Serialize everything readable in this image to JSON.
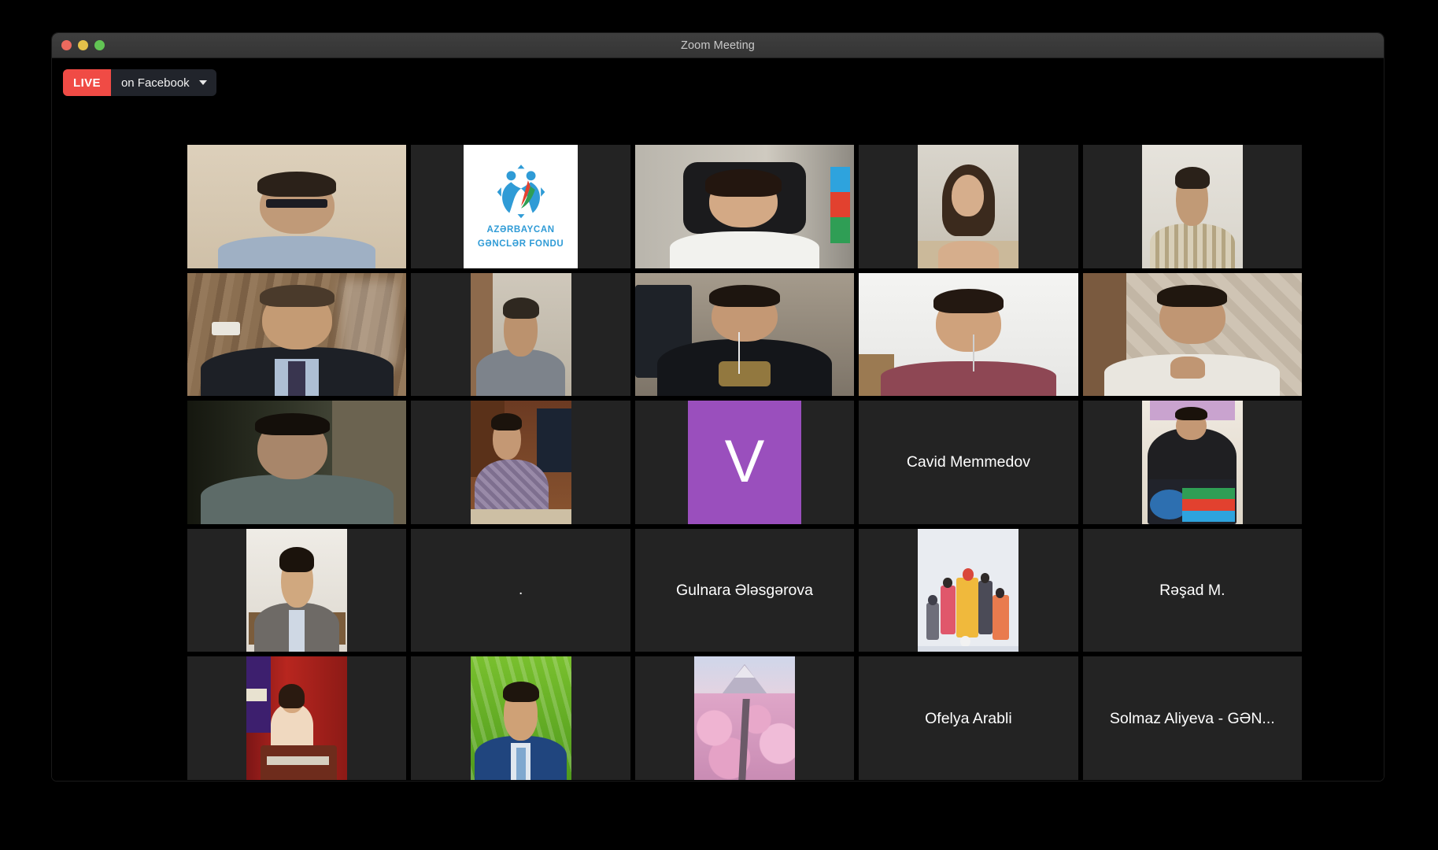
{
  "window": {
    "title": "Zoom Meeting",
    "traffic_lights": [
      "close-red",
      "minimize-yellow",
      "maximize-green"
    ]
  },
  "live": {
    "badge_label": "LIVE",
    "destination": "on Facebook",
    "caret_icon": "chevron-down-icon",
    "badge_color": "#f04b45",
    "pill_bg": "#21242b"
  },
  "gallery": {
    "columns": 5,
    "rows": 5,
    "active_speaker_border_color": "#d6e84f",
    "tile_bg": "#232323",
    "participants": [
      {
        "index": 1,
        "name": "",
        "type": "video",
        "speaking": false,
        "aspect": "full",
        "scene": "man-glasses-beige-wall"
      },
      {
        "index": 2,
        "name": "",
        "type": "logo",
        "speaking": false,
        "aspect": "portrait",
        "logo_line1": "AZƏRBAYCAN",
        "logo_line2": "GƏNCLƏR FONDU",
        "logo_color": "#2f9bd6"
      },
      {
        "index": 3,
        "name": "",
        "type": "video",
        "speaking": false,
        "aspect": "full",
        "scene": "woman-office-chair-flag"
      },
      {
        "index": 4,
        "name": "",
        "type": "video",
        "speaking": false,
        "aspect": "narrow",
        "scene": "young-woman-room"
      },
      {
        "index": 5,
        "name": "",
        "type": "video",
        "speaking": false,
        "aspect": "narrow",
        "scene": "man-plaid-shirt"
      },
      {
        "index": 6,
        "name": "",
        "type": "video",
        "speaking": true,
        "aspect": "full",
        "scene": "man-suit-wood-wall"
      },
      {
        "index": 7,
        "name": "",
        "type": "video",
        "speaking": false,
        "aspect": "narrow",
        "scene": "man-grey-shirt"
      },
      {
        "index": 8,
        "name": "",
        "type": "video",
        "speaking": false,
        "aspect": "full",
        "scene": "young-man-black-tshirt"
      },
      {
        "index": 9,
        "name": "",
        "type": "video",
        "speaking": false,
        "aspect": "full",
        "scene": "young-man-maroon-tshirt"
      },
      {
        "index": 10,
        "name": "",
        "type": "video",
        "speaking": false,
        "aspect": "full",
        "scene": "man-white-tshirt-hand-chin"
      },
      {
        "index": 11,
        "name": "",
        "type": "video",
        "speaking": false,
        "aspect": "full",
        "scene": "man-dark-room"
      },
      {
        "index": 12,
        "name": "",
        "type": "photo",
        "speaking": false,
        "aspect": "narrow",
        "scene": "man-conference-photo"
      },
      {
        "index": 13,
        "name": "",
        "type": "avatar",
        "speaking": false,
        "aspect": "portrait",
        "letter": "V",
        "avatar_color": "#9a4fbd"
      },
      {
        "index": 14,
        "name": "Cavid Memmedov",
        "type": "name",
        "speaking": false
      },
      {
        "index": 15,
        "name": "",
        "type": "photo",
        "speaking": false,
        "aspect": "narrow",
        "scene": "man-laptop-flag-photo"
      },
      {
        "index": 16,
        "name": "",
        "type": "photo",
        "speaking": false,
        "aspect": "narrow",
        "scene": "man-glasses-grey-jacket"
      },
      {
        "index": 17,
        "name": ".",
        "type": "name",
        "speaking": false
      },
      {
        "index": 18,
        "name": "Gulnara  Ələsgərova",
        "type": "name",
        "speaking": false
      },
      {
        "index": 19,
        "name": "",
        "type": "illustration",
        "speaking": false,
        "aspect": "narrow",
        "scene": "crowd-people-illustration"
      },
      {
        "index": 20,
        "name": "Rəşad M.",
        "type": "name",
        "speaking": false
      },
      {
        "index": 21,
        "name": "",
        "type": "photo",
        "speaking": false,
        "aspect": "narrow",
        "scene": "woman-podium-red-curtain"
      },
      {
        "index": 22,
        "name": "",
        "type": "photo",
        "speaking": false,
        "aspect": "narrow",
        "scene": "man-blue-suit-green-field"
      },
      {
        "index": 23,
        "name": "",
        "type": "photo",
        "speaking": false,
        "aspect": "narrow",
        "scene": "cherry-blossom-mountain"
      },
      {
        "index": 24,
        "name": "Ofelya Arabli",
        "type": "name",
        "speaking": false
      },
      {
        "index": 25,
        "name": "Solmaz Aliyeva - GƏN...",
        "type": "name",
        "speaking": false
      }
    ]
  }
}
